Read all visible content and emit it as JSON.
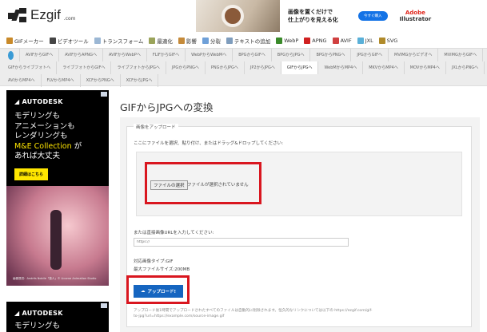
{
  "logo": {
    "name": "Ezgif",
    "suffix": ".com"
  },
  "banner": {
    "line1": "画像を置くだけで",
    "line2": "仕上がりを見える化",
    "cta": "今すぐ購入",
    "brand1": "Adobe",
    "brand2": "Illustrator"
  },
  "nav": [
    {
      "label": "GIFメーカー",
      "color": "#c98a2a"
    },
    {
      "label": "ビデオツール",
      "color": "#444"
    },
    {
      "label": "トランスフォーム",
      "color": "#9bb7d4"
    },
    {
      "label": "最適化",
      "color": "#9aa35a"
    },
    {
      "label": "影響",
      "color": "#c58a3a"
    },
    {
      "label": "分裂",
      "color": "#6fa0d8"
    },
    {
      "label": "テキストの追加",
      "color": "#7f9dbd"
    },
    {
      "label": "WebP",
      "color": "#3a8a2a"
    },
    {
      "label": "APNG",
      "color": "#d02020"
    },
    {
      "label": "AVIF",
      "color": "#d04040"
    },
    {
      "label": "JXL",
      "color": "#5ab0d8"
    },
    {
      "label": "SVG",
      "color": "#b08a2a"
    }
  ],
  "tabs": [
    "AVIFからGIFへ",
    "AVIFからAPNGへ",
    "AVIFからWebPへ",
    "FLIFからGIFへ",
    "WebPからWebMへ",
    "BPGからGIFへ",
    "BPGからJPGへ",
    "BPGからPNGへ",
    "JPGからGIFへ",
    "MVIMGからビデオへ",
    "MVIMGからGIFへ",
    "GIFからライブフォトへ",
    "ライブフォトからGIFへ",
    "ライブフォトからJPGへ",
    "JPGからPNGへ",
    "PNGからJPGへ",
    "JP2からJPGへ",
    "GIFからJPGへ",
    "WebMからMP4へ",
    "MKVからMP4へ",
    "MOVからMP4へ",
    "JXLからPNGへ",
    "AVIからMP4へ",
    "FLVからMP4へ",
    "XCFからPNGへ",
    "XCFからJPGへ"
  ],
  "active_tab": "GIFからJPGへ",
  "ad": {
    "brand": "AUTODESK",
    "l1": "モデリングも",
    "l2": "アニメーションも",
    "l3": "レンダリングも",
    "l4a": "M&E Collection",
    "l4b": " が",
    "l5": "あれば大丈夫",
    "cta": "詳細はこちら",
    "credit": "画像提供：Andrés Nobile「旅人」© Licorne Animation Studio"
  },
  "main": {
    "title": "GIFからJPGへの変換",
    "legend": "画像をアップロード",
    "instruction": "ここにファイルを選択、貼り付け、またはドラッグ&ドロップしてください:",
    "file_button": "ファイルの選択",
    "no_file": "ファイルが選択されていません",
    "url_label": "または直接画像URLを入力してください:",
    "url_placeholder": "https://",
    "types": "対応画像タイプ:GIF",
    "max_size": "最大ファイルサイズ:200MB",
    "upload": "アップロード!",
    "note": "アップロード後1時間でアップロードされたすべてのファイルは自動的に削除されます。恒久的なリンクについては以下の https://ezgif.com/gif-to-jpg?url=https://example.com/source-image.gif"
  }
}
